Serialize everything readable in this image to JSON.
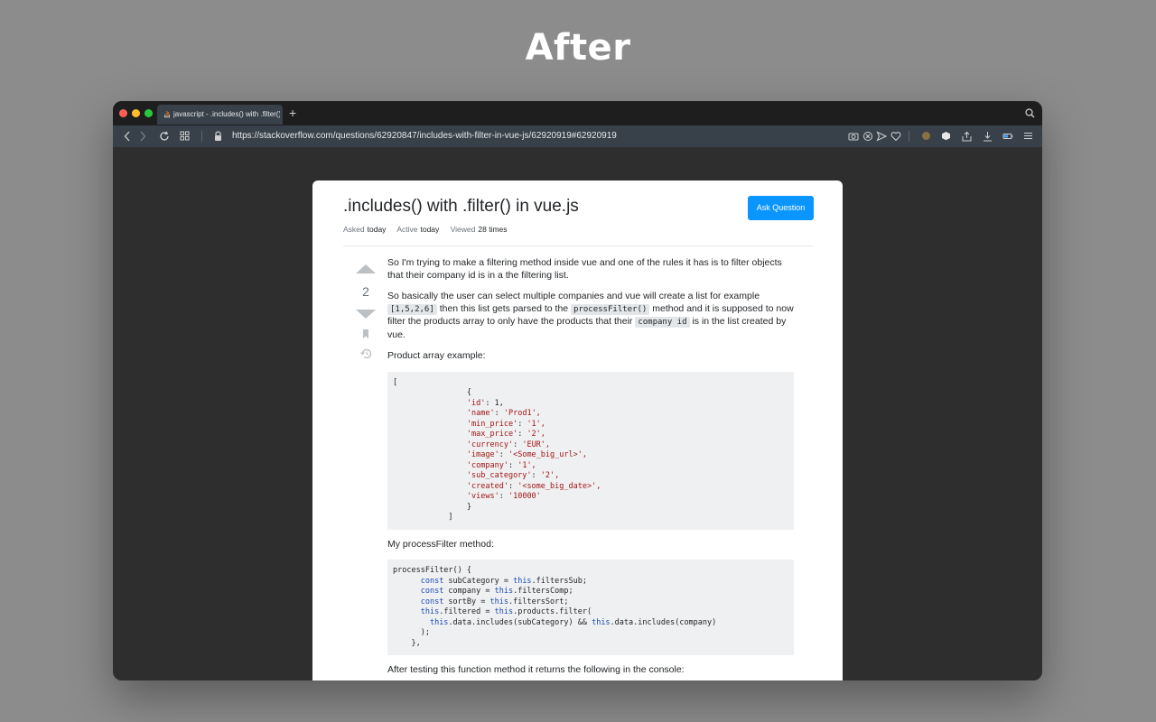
{
  "headline": "After",
  "browser": {
    "tab_title": "javascript - .includes() with .filter() in vue.js - Stack Overflow",
    "new_tab": "+",
    "url": "https://stackoverflow.com/questions/62920847/includes-with-filter-in-vue-js/62920919#62920919"
  },
  "question": {
    "title": ".includes() with .filter() in vue.js",
    "ask_button": "Ask Question",
    "meta": {
      "asked_label": "Asked",
      "asked_value": "today",
      "active_label": "Active",
      "active_value": "today",
      "viewed_label": "Viewed",
      "viewed_value": "28 times"
    },
    "votes": "2",
    "body": {
      "p1": "So I'm trying to make a filtering method inside vue and one of the rules it has is to filter objects that their company id is in a the filtering list.",
      "p2_a": "So basically the user can select multiple companies and vue will create a list for example",
      "p2_code1": "[1,5,2,6]",
      "p2_b": "then this list gets parsed to the",
      "p2_code2": "processFilter()",
      "p2_c": "method and it is supposed to now filter the products array to only have the products that their",
      "p2_code3": "company id",
      "p2_d": "is in the list created by vue.",
      "p3": "Product array example:",
      "code_block_1": {
        "open_bracket": "[",
        "open_brace": "{",
        "lines": [
          {
            "key": "'id'",
            "value": "1,"
          },
          {
            "key": "'name'",
            "value": "'Prod1',"
          },
          {
            "key": "'min_price'",
            "value": "'1',"
          },
          {
            "key": "'max_price'",
            "value": "'2',"
          },
          {
            "key": "'currency'",
            "value": "'EUR',"
          },
          {
            "key": "'image'",
            "value": "'<Some_big_url>',"
          },
          {
            "key": "'company'",
            "value": "'1',"
          },
          {
            "key": "'sub_category'",
            "value": "'2',"
          },
          {
            "key": "'created'",
            "value": "'<some_big_date>',"
          },
          {
            "key": "'views'",
            "value": "'10000'"
          }
        ],
        "close_brace": "}",
        "close_bracket": "]"
      },
      "p4": "My processFilter method:",
      "code_block_2": {
        "l1": "processFilter() {",
        "l2_kw": "const",
        "l2_rest": " subCategory = ",
        "l2_this": "this",
        "l2_end": ".filtersSub;",
        "l3_kw": "const",
        "l3_rest": " company = ",
        "l3_this": "this",
        "l3_end": ".filtersComp;",
        "l4_kw": "const",
        "l4_rest": " sortBy = ",
        "l4_this": "this",
        "l4_end": ".filtersSort;",
        "l5_this1": "this",
        "l5_mid": ".filtered = ",
        "l5_this2": "this",
        "l5_end": ".products.filter(",
        "l6_this1": "this",
        "l6_mid": ".data.includes(subCategory) && ",
        "l6_this2": "this",
        "l6_end": ".data.includes(company)",
        "l7": ");",
        "l8": "},"
      },
      "p5": "After testing this function method it returns the following in the console:"
    }
  }
}
